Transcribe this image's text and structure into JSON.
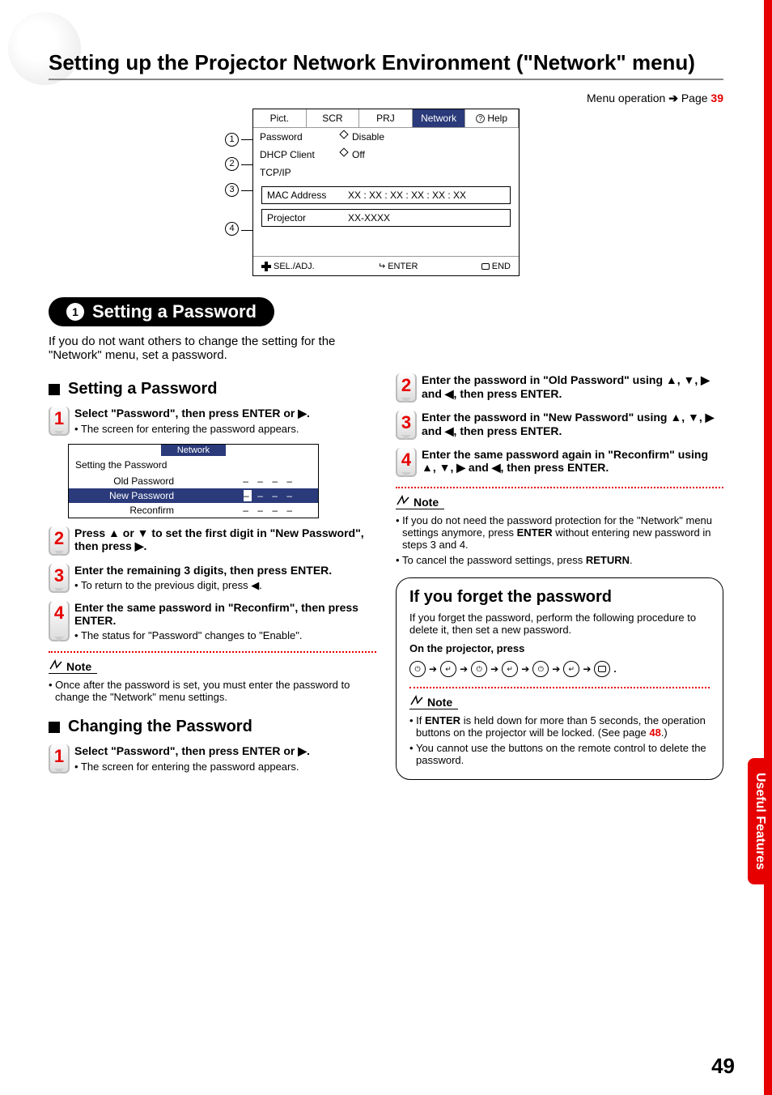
{
  "sideTab": "Useful\nFeatures",
  "pageTitle": "Setting up the Projector Network Environment (\"Network\" menu)",
  "menuOp": {
    "text": "Menu operation",
    "arrow": "➔",
    "pageWord": "Page",
    "page": "39"
  },
  "osd": {
    "tabs": [
      "Pict.",
      "SCR",
      "PRJ",
      "Network",
      "Help"
    ],
    "rows": [
      {
        "label": "Password",
        "value": "Disable"
      },
      {
        "label": "DHCP Client",
        "value": "Off"
      },
      {
        "label": "TCP/IP",
        "value": ""
      }
    ],
    "mac": {
      "label": "MAC Address",
      "value": "XX : XX : XX : XX : XX : XX"
    },
    "proj": {
      "label": "Projector",
      "value": "XX-XXXX"
    },
    "footer": [
      "SEL./ADJ.",
      "ENTER",
      "END"
    ]
  },
  "pill": {
    "num": "1",
    "text": "Setting a Password"
  },
  "intro": "If you do not want others to change the setting for the \"Network\" menu, set a password.",
  "left": {
    "heading1": "Setting a Password",
    "steps1": [
      {
        "n": "1",
        "bold": "Select \"Password\", then press ENTER or ▶.",
        "sub": [
          "The screen for entering the password appears."
        ]
      },
      {
        "n": "2",
        "bold": "Press ▲ or ▼ to set the first digit in \"New Password\", then press ▶."
      },
      {
        "n": "3",
        "bold": "Enter the remaining 3 digits, then press ENTER.",
        "sub": [
          "To return to the previous digit, press ◀."
        ]
      },
      {
        "n": "4",
        "bold": "Enter the same password in \"Reconfirm\", then press ENTER.",
        "sub": [
          "The status for \"Password\" changes to \"Enable\"."
        ]
      }
    ],
    "miniOsd": {
      "hdr": "Network",
      "title": "Setting the Password",
      "rows": [
        {
          "l": "Old Password",
          "v": "– – – –"
        },
        {
          "l": "New Password",
          "sel": true
        },
        {
          "l": "Reconfirm",
          "v": "– – – –"
        }
      ]
    },
    "note1": [
      "Once after the password is set, you must enter the password to change the \"Network\" menu settings."
    ],
    "heading2": "Changing the Password",
    "steps2": [
      {
        "n": "1",
        "bold": "Select \"Password\", then press ENTER or ▶.",
        "sub": [
          "The screen for entering the password appears."
        ]
      }
    ]
  },
  "right": {
    "steps": [
      {
        "n": "2",
        "bold": "Enter the password in \"Old Password\" using ▲, ▼, ▶ and ◀, then press ENTER."
      },
      {
        "n": "3",
        "bold": "Enter the password in \"New Password\" using ▲, ▼, ▶ and ◀, then press ENTER."
      },
      {
        "n": "4",
        "bold": "Enter the same password again in \"Reconfirm\" using ▲, ▼, ▶ and ◀, then press ENTER."
      }
    ],
    "noteLabel": "Note",
    "note": [
      "If you do not need the password protection for the \"Network\" menu settings anymore, press ENTER without entering new password in steps 3 and 4.",
      "To cancel the password settings, press RETURN."
    ],
    "forget": {
      "title": "If you forget the password",
      "p": "If you forget the password, perform the following procedure to delete it, then set a new password.",
      "onProj": "On the projector, press",
      "note": [
        "If ENTER is held down for more than 5 seconds, the operation buttons on the projector will be locked. (See page 48.)",
        "You cannot use the buttons on the remote control to delete the password."
      ],
      "pageRef": "48"
    }
  },
  "pageNum": "49"
}
